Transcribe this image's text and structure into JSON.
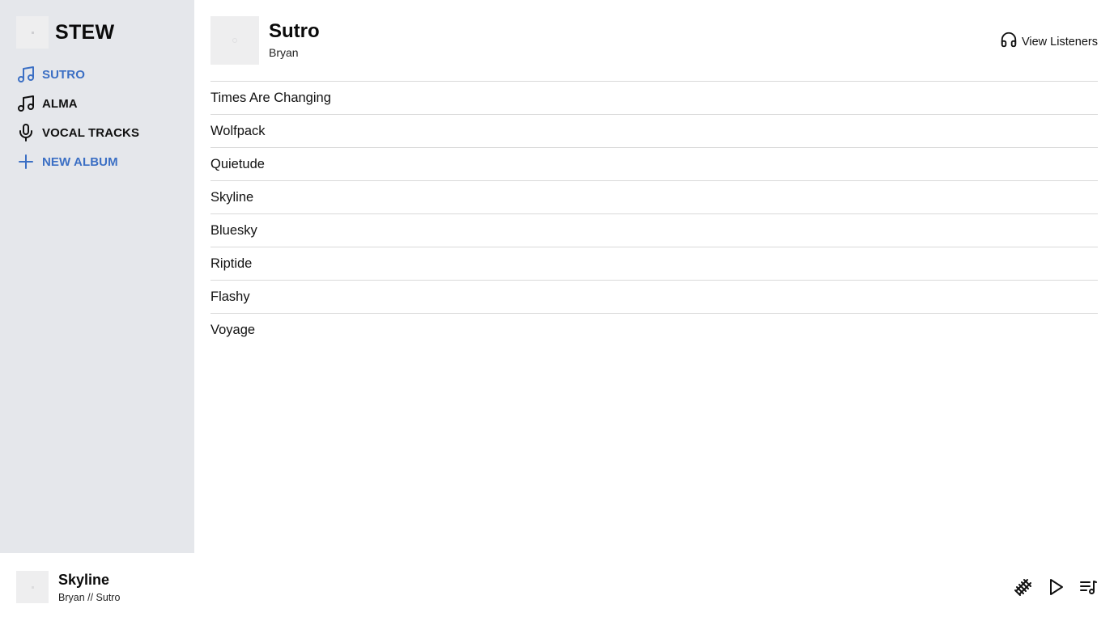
{
  "app": {
    "title": "STEW"
  },
  "sidebar": {
    "items": [
      {
        "label": "SUTRO",
        "icon": "music-note-icon",
        "state": "active",
        "color": "#3b6fc4"
      },
      {
        "label": "ALMA",
        "icon": "music-note-icon",
        "state": "normal",
        "color": "#111111"
      },
      {
        "label": "VOCAL TRACKS",
        "icon": "microphone-icon",
        "state": "normal",
        "color": "#111111"
      },
      {
        "label": "NEW ALBUM",
        "icon": "plus-icon",
        "state": "action",
        "color": "#3b6fc4"
      }
    ]
  },
  "album": {
    "title": "Sutro",
    "artist": "Bryan",
    "listeners_label": "View Listeners",
    "listeners_icon": "headphones-icon",
    "tracks": [
      "Times Are Changing",
      "Wolfpack",
      "Quietude",
      "Skyline",
      "Bluesky",
      "Riptide",
      "Flashy",
      "Voyage"
    ]
  },
  "now_playing": {
    "title": "Skyline",
    "subtitle": "Bryan // Sutro",
    "controls": [
      "railroad-track-icon",
      "play-icon",
      "queue-music-icon"
    ]
  },
  "colors": {
    "sidebar_bg": "#e5e7eb",
    "accent": "#3b6fc4",
    "divider": "#d9d9d9"
  }
}
